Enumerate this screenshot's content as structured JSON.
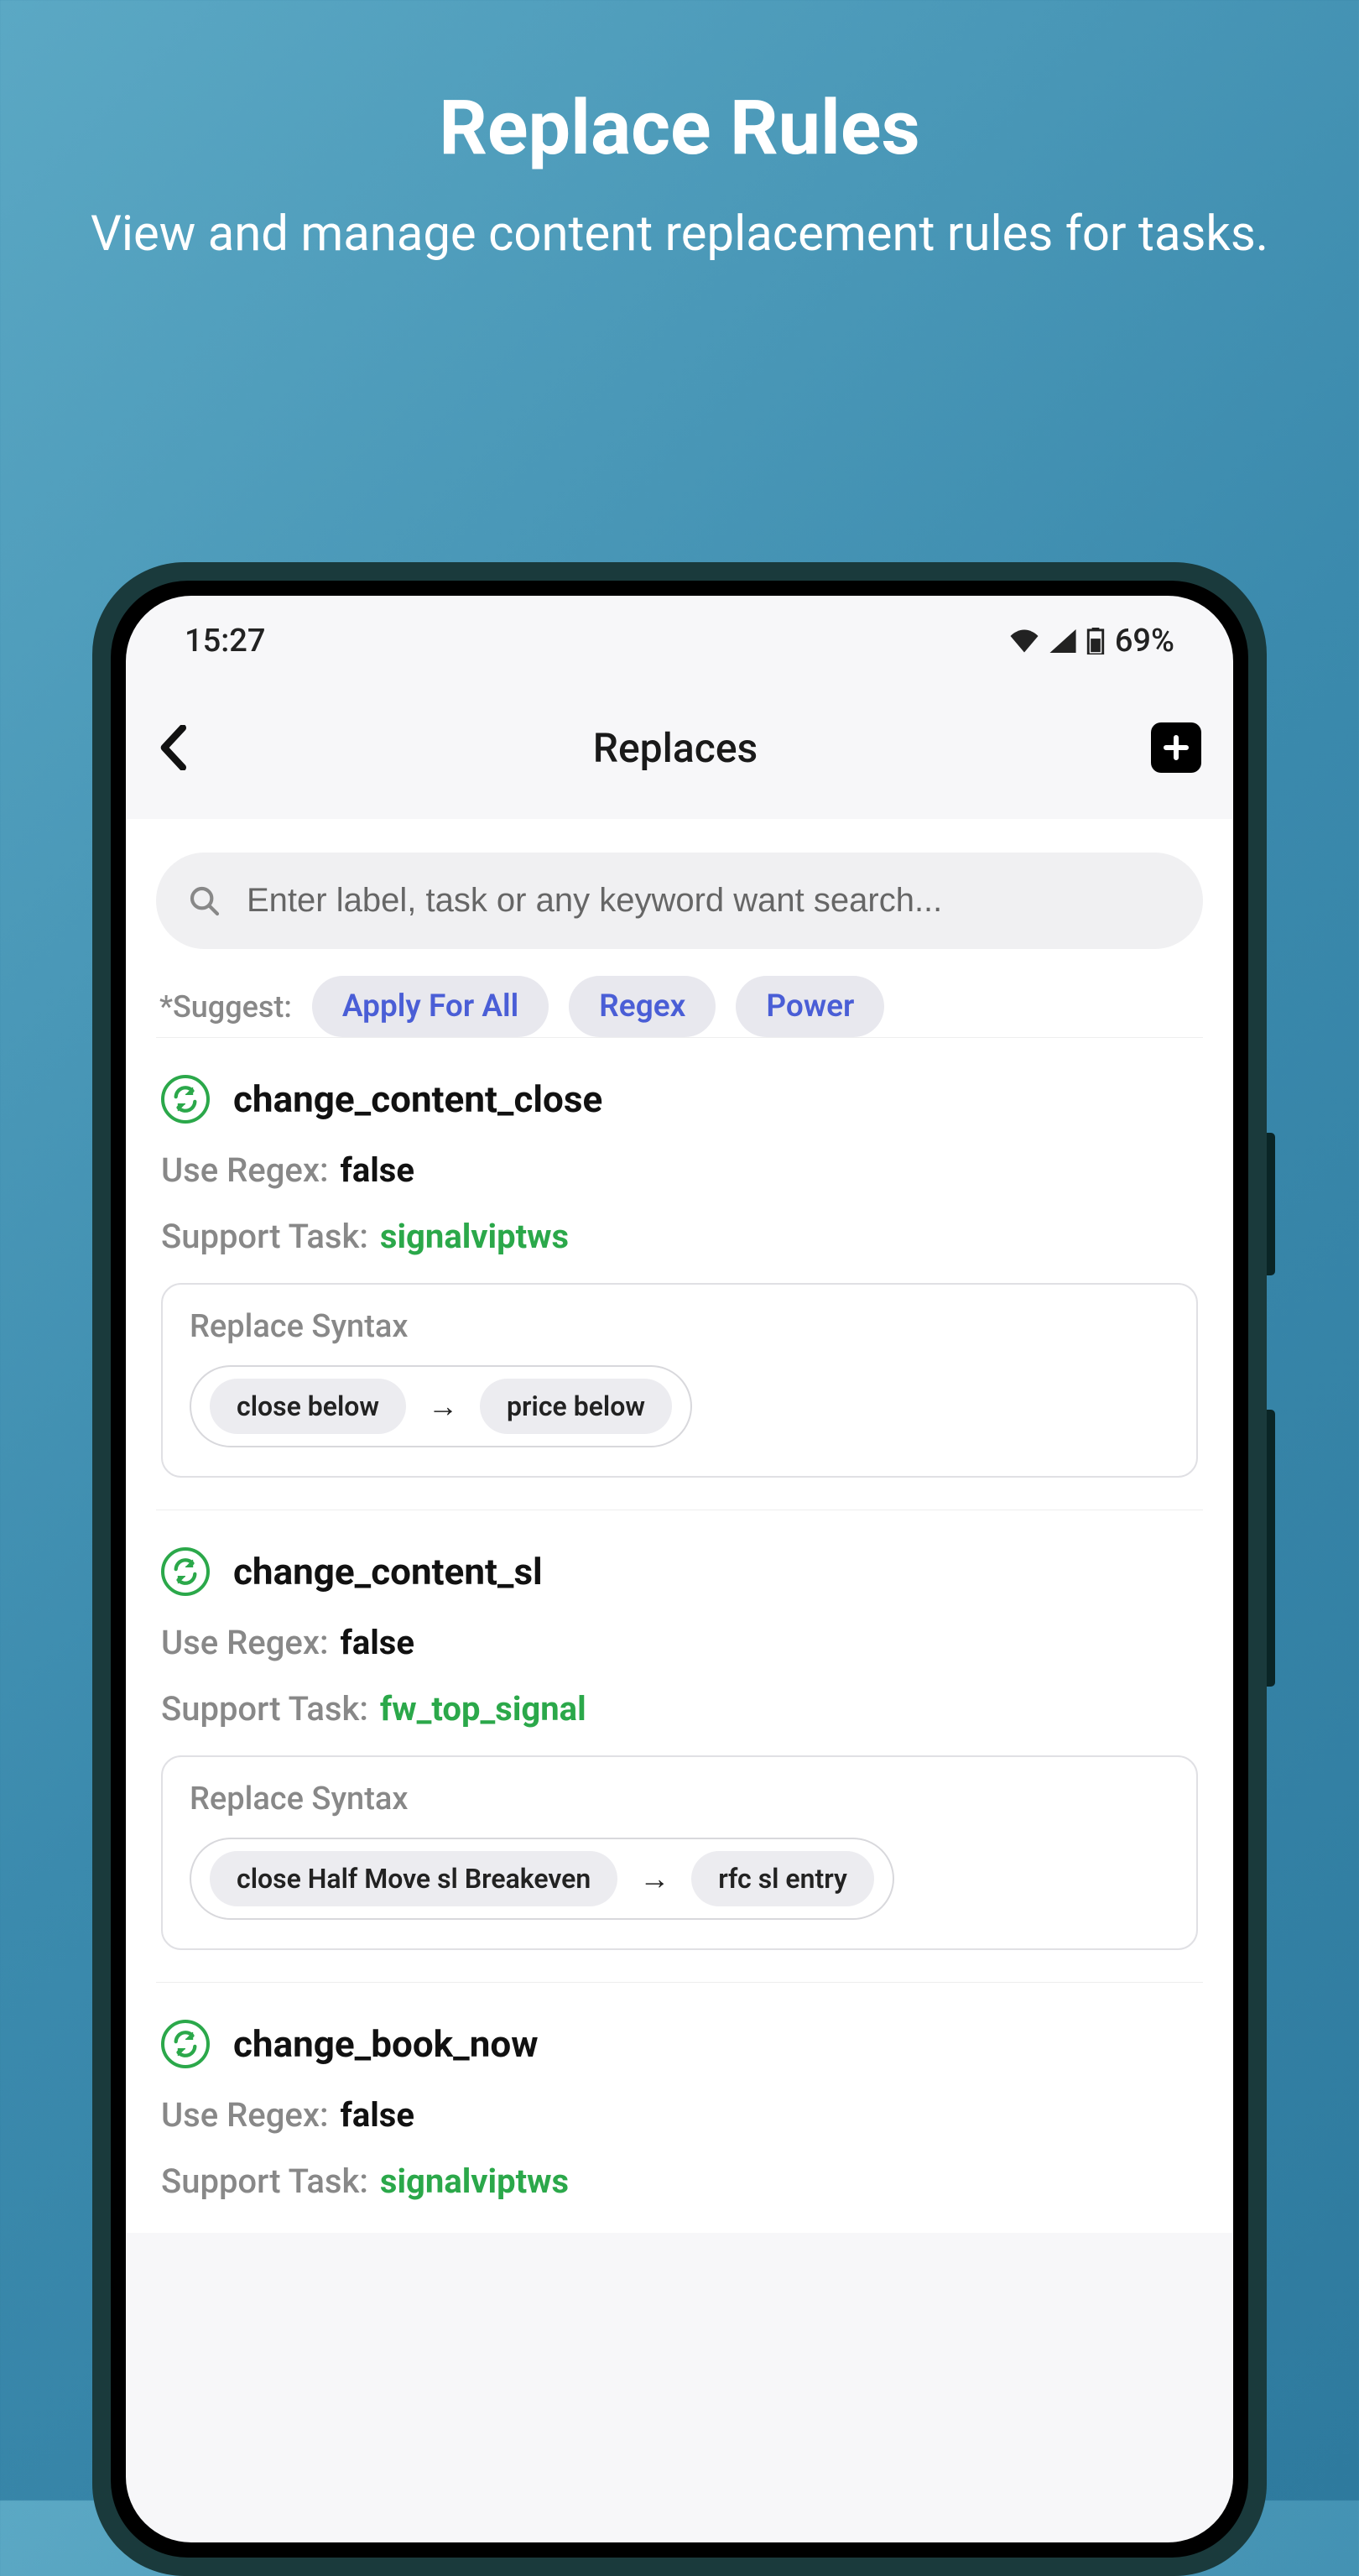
{
  "promo": {
    "title": "Replace Rules",
    "subtitle": "View and manage content replacement rules for tasks."
  },
  "status_bar": {
    "time": "15:27",
    "battery": "69%"
  },
  "header": {
    "title": "Replaces"
  },
  "search": {
    "placeholder": "Enter label, task or any keyword want search..."
  },
  "suggest": {
    "label": "*Suggest:",
    "chips": [
      "Apply For All",
      "Regex",
      "Power"
    ]
  },
  "meta_labels": {
    "use_regex": "Use Regex:",
    "support_task": "Support Task:",
    "replace_syntax": "Replace Syntax"
  },
  "rules": [
    {
      "name": "change_content_close",
      "use_regex": "false",
      "support_task": "signalviptws",
      "from": "close below",
      "to": "price below"
    },
    {
      "name": "change_content_sl",
      "use_regex": "false",
      "support_task": "fw_top_signal",
      "from": "close Half Move sl Breakeven",
      "to": "rfc sl entry"
    },
    {
      "name": "change_book_now",
      "use_regex": "false",
      "support_task": "signalviptws",
      "from": "",
      "to": ""
    }
  ]
}
